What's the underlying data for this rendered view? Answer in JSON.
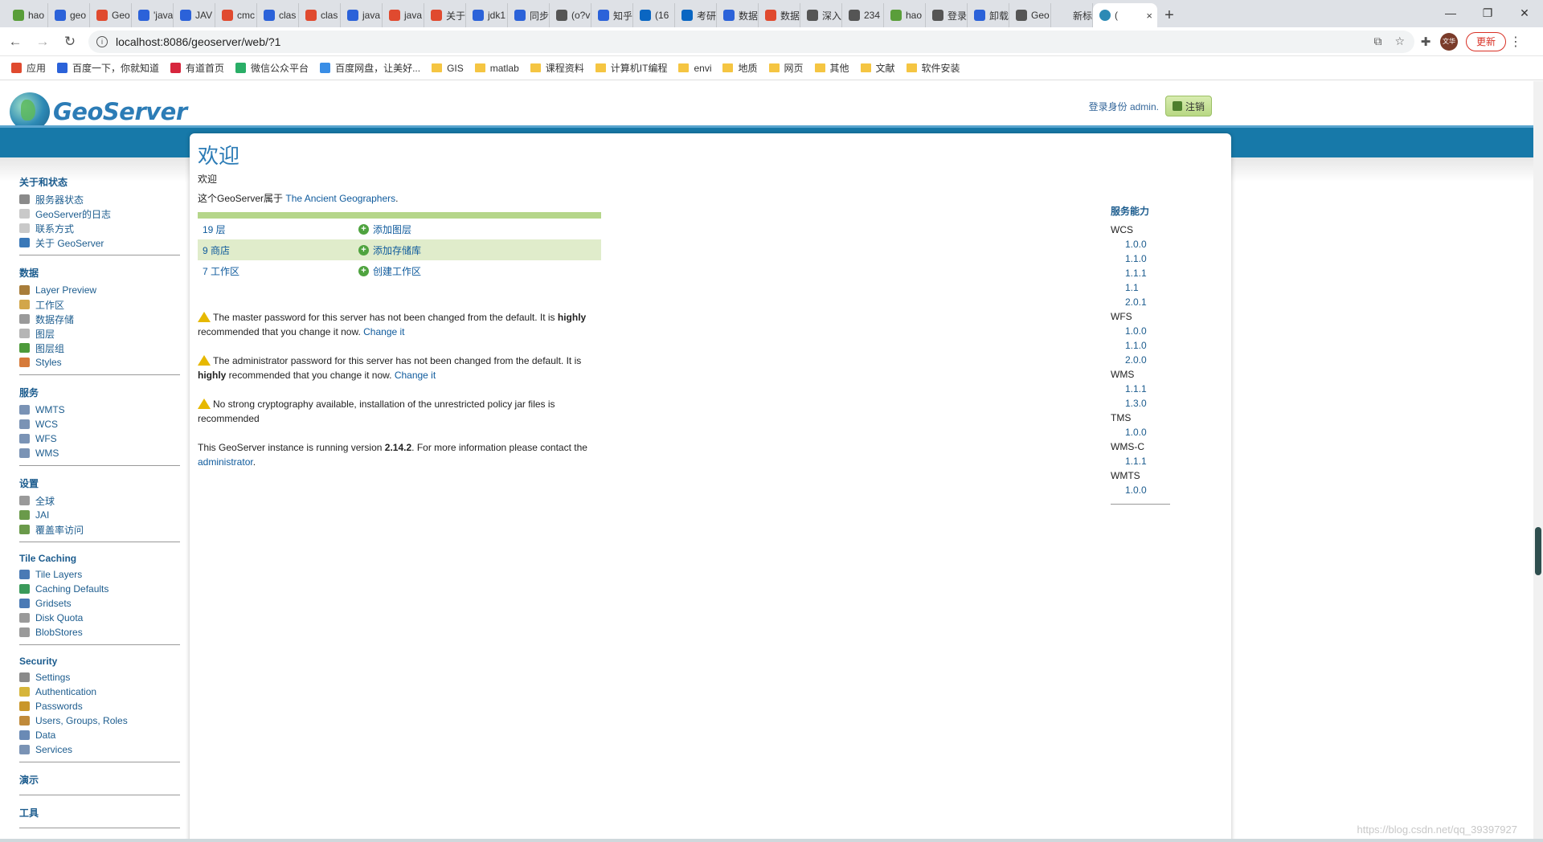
{
  "browser": {
    "tabs": [
      {
        "label": "hao",
        "color": "#5a9e3a"
      },
      {
        "label": "geo",
        "color": "#2b62d9"
      },
      {
        "label": "Geo",
        "color": "#e04a2f"
      },
      {
        "label": "'java",
        "color": "#2b62d9"
      },
      {
        "label": "JAV",
        "color": "#2b62d9"
      },
      {
        "label": "cmc",
        "color": "#e04a2f"
      },
      {
        "label": "clas",
        "color": "#2b62d9"
      },
      {
        "label": "clas",
        "color": "#e04a2f"
      },
      {
        "label": "java",
        "color": "#2b62d9"
      },
      {
        "label": "java",
        "color": "#e04a2f"
      },
      {
        "label": "关于",
        "color": "#e04a2f"
      },
      {
        "label": "jdk1",
        "color": "#2b62d9"
      },
      {
        "label": "同步",
        "color": "#2b62d9"
      },
      {
        "label": "(o?v",
        "color": "#555555"
      },
      {
        "label": "知乎",
        "color": "#2b62d9"
      },
      {
        "label": "(16",
        "color": "#0a66c2"
      },
      {
        "label": "考研",
        "color": "#0a66c2"
      },
      {
        "label": "数据",
        "color": "#2b62d9"
      },
      {
        "label": "数据",
        "color": "#e04a2f"
      },
      {
        "label": "深入",
        "color": "#555555"
      },
      {
        "label": "234",
        "color": "#555555"
      },
      {
        "label": "hao",
        "color": "#5a9e3a"
      },
      {
        "label": "登录",
        "color": "#555555"
      },
      {
        "label": "卸载",
        "color": "#2b62d9"
      },
      {
        "label": "Geo",
        "color": "#555555"
      },
      {
        "label": "新标签页",
        "color": "#dee1e6"
      }
    ],
    "active_tab": {
      "label": "(",
      "close": "×"
    },
    "new_tab": "+",
    "window_controls": [
      "—",
      "❐",
      "✕"
    ],
    "url": "localhost:8086/geoserver/web/?1",
    "update_label": "更新",
    "avatar_text": "文华",
    "bookmarks": [
      {
        "label": "应用",
        "type": "apps"
      },
      {
        "label": "百度一下，你就知道",
        "type": "baidu"
      },
      {
        "label": "有道首页",
        "type": "youdao"
      },
      {
        "label": "微信公众平台",
        "type": "wechat"
      },
      {
        "label": "百度网盘，让美好...",
        "type": "pan"
      },
      {
        "label": "GIS",
        "type": "folder"
      },
      {
        "label": "matlab",
        "type": "folder"
      },
      {
        "label": "课程资料",
        "type": "folder"
      },
      {
        "label": "计算机IT编程",
        "type": "folder"
      },
      {
        "label": "envi",
        "type": "folder"
      },
      {
        "label": "地质",
        "type": "folder"
      },
      {
        "label": "网页",
        "type": "folder"
      },
      {
        "label": "其他",
        "type": "folder"
      },
      {
        "label": "文献",
        "type": "folder"
      },
      {
        "label": "软件安装",
        "type": "folder"
      }
    ]
  },
  "header": {
    "logo_text": "GeoServer",
    "login_text": "登录身份 admin.",
    "logout_label": "注销"
  },
  "sidebar": [
    {
      "title": "关于和状态",
      "items": [
        {
          "label": "服务器状态",
          "icon": "#8a8a8a"
        },
        {
          "label": "GeoServer的日志",
          "icon": "#c9c9c9"
        },
        {
          "label": "联系方式",
          "icon": "#c9c9c9"
        },
        {
          "label": "关于 GeoServer",
          "icon": "#3a78b8"
        }
      ]
    },
    {
      "title": "数据",
      "items": [
        {
          "label": "Layer Preview",
          "icon": "#a87d3a"
        },
        {
          "label": "工作区",
          "icon": "#d2a64a"
        },
        {
          "label": "数据存储",
          "icon": "#9a9a9a"
        },
        {
          "label": "图层",
          "icon": "#b5b5b5"
        },
        {
          "label": "图层组",
          "icon": "#4d9a3a"
        },
        {
          "label": "Styles",
          "icon": "#d67a3a"
        }
      ]
    },
    {
      "title": "服务",
      "items": [
        {
          "label": "WMTS",
          "icon": "#7a93b5"
        },
        {
          "label": "WCS",
          "icon": "#7a93b5"
        },
        {
          "label": "WFS",
          "icon": "#7a93b5"
        },
        {
          "label": "WMS",
          "icon": "#7a93b5"
        }
      ]
    },
    {
      "title": "设置",
      "items": [
        {
          "label": "全球",
          "icon": "#9a9a9a"
        },
        {
          "label": "JAI",
          "icon": "#6a9a4a"
        },
        {
          "label": "覆盖率访问",
          "icon": "#6a9a4a"
        }
      ]
    },
    {
      "title": "Tile Caching",
      "items": [
        {
          "label": "Tile Layers",
          "icon": "#4a7ab5"
        },
        {
          "label": "Caching Defaults",
          "icon": "#3a9a5a"
        },
        {
          "label": "Gridsets",
          "icon": "#4a7ab5"
        },
        {
          "label": "Disk Quota",
          "icon": "#9a9a9a"
        },
        {
          "label": "BlobStores",
          "icon": "#9a9a9a"
        }
      ]
    },
    {
      "title": "Security",
      "items": [
        {
          "label": "Settings",
          "icon": "#8a8a8a"
        },
        {
          "label": "Authentication",
          "icon": "#d6b53a"
        },
        {
          "label": "Passwords",
          "icon": "#c9962a"
        },
        {
          "label": "Users, Groups, Roles",
          "icon": "#c08a3a"
        },
        {
          "label": "Data",
          "icon": "#6a8ab5"
        },
        {
          "label": "Services",
          "icon": "#7a93b5"
        }
      ]
    },
    {
      "title": "演示",
      "items": []
    },
    {
      "title": "工具",
      "items": []
    }
  ],
  "main": {
    "title": "欢迎",
    "subtitle": "欢迎",
    "owner_prefix": "这个GeoServer属于 ",
    "owner_link": "The Ancient Geographers",
    "owner_suffix": ".",
    "summary": [
      {
        "count": "19 层",
        "action": "添加图层"
      },
      {
        "count": "9 商店",
        "action": "添加存储库"
      },
      {
        "count": "7 工作区",
        "action": "创建工作区"
      }
    ],
    "warnings": [
      {
        "before": "The master password for this server has not been changed from the default. It is ",
        "bold": "highly",
        "after": " recommended that you change it now. ",
        "link": "Change it"
      },
      {
        "before": "The administrator password for this server has not been changed from the default. It is ",
        "bold": "highly",
        "after": " recommended that you change it now. ",
        "link": "Change it"
      },
      {
        "before": "No strong cryptography available, installation of the unrestricted policy jar files is recommended",
        "bold": "",
        "after": "",
        "link": ""
      }
    ],
    "version_before": "This GeoServer instance is running version ",
    "version": "2.14.2",
    "version_after": ". For more information please contact the ",
    "version_link": "administrator",
    "version_end": "."
  },
  "services": {
    "title": "服务能力",
    "list": [
      {
        "name": "WCS",
        "versions": [
          "1.0.0",
          "1.1.0",
          "1.1.1",
          "1.1",
          "2.0.1"
        ]
      },
      {
        "name": "WFS",
        "versions": [
          "1.0.0",
          "1.1.0",
          "2.0.0"
        ]
      },
      {
        "name": "WMS",
        "versions": [
          "1.1.1",
          "1.3.0"
        ]
      },
      {
        "name": "TMS",
        "versions": [
          "1.0.0"
        ]
      },
      {
        "name": "WMS-C",
        "versions": [
          "1.1.1"
        ]
      },
      {
        "name": "WMTS",
        "versions": [
          "1.0.0"
        ]
      }
    ]
  },
  "watermark": "https://blog.csdn.net/qq_39397927"
}
